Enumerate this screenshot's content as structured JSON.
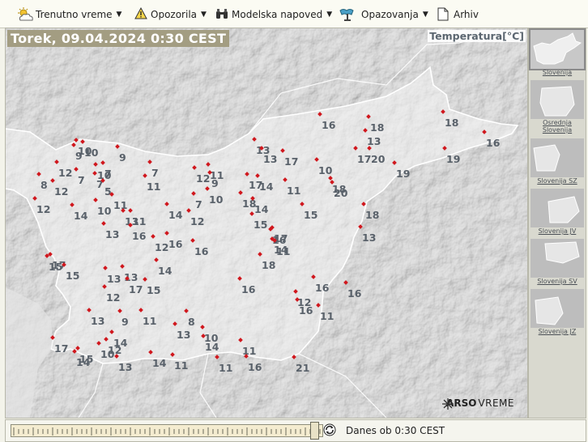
{
  "menu": [
    {
      "label": "Trenutno vreme",
      "icon": "sun-cloud-icon",
      "dropdown": true
    },
    {
      "label": "Opozorila",
      "icon": "warning-icon",
      "dropdown": true
    },
    {
      "label": "Modelska napoved",
      "icon": "binoculars-icon",
      "dropdown": true
    },
    {
      "label": "Opazovanja",
      "icon": "station-icon",
      "dropdown": true
    },
    {
      "label": "Arhiv",
      "icon": "document-icon",
      "dropdown": false
    }
  ],
  "map": {
    "datetime": "Torek, 09.04.2024 0:30 CEST",
    "variable": "Temperatura[°C]",
    "logo": {
      "brand": "ARSO",
      "text": "VREME",
      "icon": "arso-logo-icon"
    },
    "accent": "#d0181e",
    "temperatures": [
      {
        "v": "16"
      },
      {
        "v": "18"
      },
      {
        "v": "18"
      },
      {
        "v": "16"
      },
      {
        "v": "13"
      },
      {
        "v": "13"
      },
      {
        "v": "13"
      },
      {
        "v": "17"
      },
      {
        "v": "17"
      },
      {
        "v": "20"
      },
      {
        "v": "19"
      },
      {
        "v": "19"
      },
      {
        "v": "10"
      },
      {
        "v": "12"
      },
      {
        "v": "9"
      },
      {
        "v": "10"
      },
      {
        "v": "9"
      },
      {
        "v": "10"
      },
      {
        "v": "7"
      },
      {
        "v": "7"
      },
      {
        "v": "7"
      },
      {
        "v": "7"
      },
      {
        "v": "8"
      },
      {
        "v": "12"
      },
      {
        "v": "11"
      },
      {
        "v": "12"
      },
      {
        "v": "11"
      },
      {
        "v": "9"
      },
      {
        "v": "17"
      },
      {
        "v": "14"
      },
      {
        "v": "5"
      },
      {
        "v": "7"
      },
      {
        "v": "10"
      },
      {
        "v": "11"
      },
      {
        "v": "10"
      },
      {
        "v": "18"
      },
      {
        "v": "14"
      },
      {
        "v": "12"
      },
      {
        "v": "14"
      },
      {
        "v": "14"
      },
      {
        "v": "10"
      },
      {
        "v": "18"
      },
      {
        "v": "13"
      },
      {
        "v": "11"
      },
      {
        "v": "15"
      },
      {
        "v": "20"
      },
      {
        "v": "15"
      },
      {
        "v": "18"
      },
      {
        "v": "13"
      },
      {
        "v": "13"
      },
      {
        "v": "12"
      },
      {
        "v": "11"
      },
      {
        "v": "16"
      },
      {
        "v": "16"
      },
      {
        "v": "16"
      },
      {
        "v": "12"
      },
      {
        "v": "17"
      },
      {
        "v": "14"
      },
      {
        "v": "16"
      },
      {
        "v": "11"
      },
      {
        "v": "15"
      },
      {
        "v": "17"
      },
      {
        "v": "15"
      },
      {
        "v": "13"
      },
      {
        "v": "13"
      },
      {
        "v": "14"
      },
      {
        "v": "17"
      },
      {
        "v": "15"
      },
      {
        "v": "12"
      },
      {
        "v": "16"
      },
      {
        "v": "18"
      },
      {
        "v": "12"
      },
      {
        "v": "16"
      },
      {
        "v": "13"
      },
      {
        "v": "9"
      },
      {
        "v": "11"
      },
      {
        "v": "8"
      },
      {
        "v": "13"
      },
      {
        "v": "10"
      },
      {
        "v": "16"
      },
      {
        "v": "16"
      },
      {
        "v": "11"
      },
      {
        "v": "14"
      },
      {
        "v": "11"
      },
      {
        "v": "14"
      },
      {
        "v": "17"
      },
      {
        "v": "15"
      },
      {
        "v": "12"
      },
      {
        "v": "14"
      },
      {
        "v": "10"
      },
      {
        "v": "13"
      },
      {
        "v": "14"
      },
      {
        "v": "11"
      },
      {
        "v": "11"
      },
      {
        "v": "16"
      },
      {
        "v": "21"
      }
    ]
  },
  "regions": [
    {
      "label": "Slovenija",
      "selected": true
    },
    {
      "label": "Osrednja Slovenija",
      "selected": false
    },
    {
      "label": "Slovenija SZ",
      "selected": false
    },
    {
      "label": "Slovenija JV",
      "selected": false
    },
    {
      "label": "Slovenija SV",
      "selected": false
    },
    {
      "label": "Slovenija JZ",
      "selected": false
    }
  ],
  "timebar": {
    "label": "Danes ob 0:30 CEST",
    "refresh_icon": "refresh-icon"
  }
}
